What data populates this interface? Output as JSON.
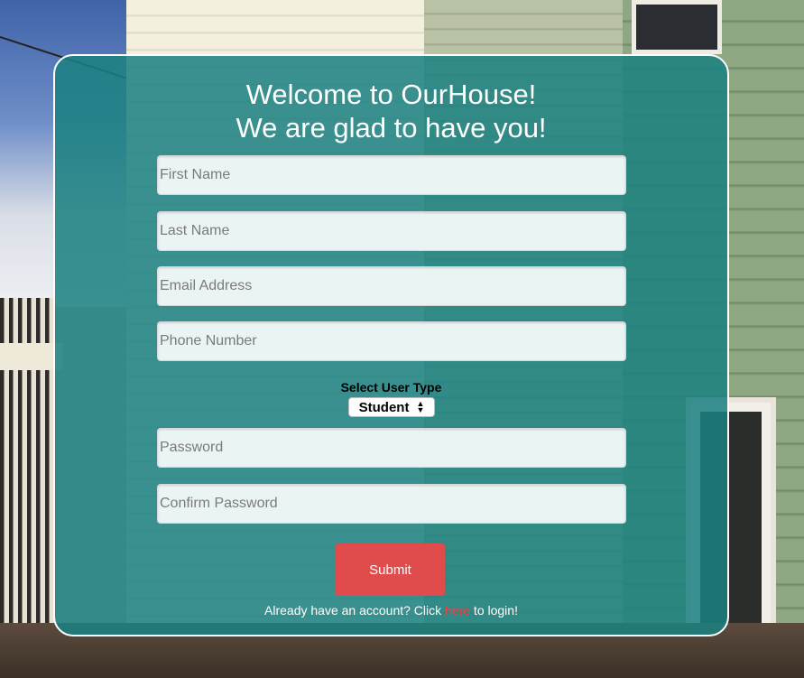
{
  "header": {
    "title_line1": "Welcome to OurHouse!",
    "title_line2": "We are glad to have you!"
  },
  "form": {
    "first_name": {
      "value": "",
      "placeholder": "First Name"
    },
    "last_name": {
      "value": "",
      "placeholder": "Last Name"
    },
    "email": {
      "value": "",
      "placeholder": "Email Address"
    },
    "phone": {
      "value": "",
      "placeholder": "Phone Number"
    },
    "user_type": {
      "label": "Select User Type",
      "selected": "Student"
    },
    "password": {
      "value": "",
      "placeholder": "Password"
    },
    "confirm_password": {
      "value": "",
      "placeholder": "Confirm Password"
    },
    "submit_label": "Submit"
  },
  "login": {
    "prefix": "Already have an account? Click ",
    "link_text": "here",
    "suffix": " to login!"
  },
  "colors": {
    "card_background": "#1b8080",
    "submit_button": "#e04b4b",
    "login_link": "#e84545"
  },
  "icons": {
    "select_arrows": "up-down-chevron-icon"
  }
}
